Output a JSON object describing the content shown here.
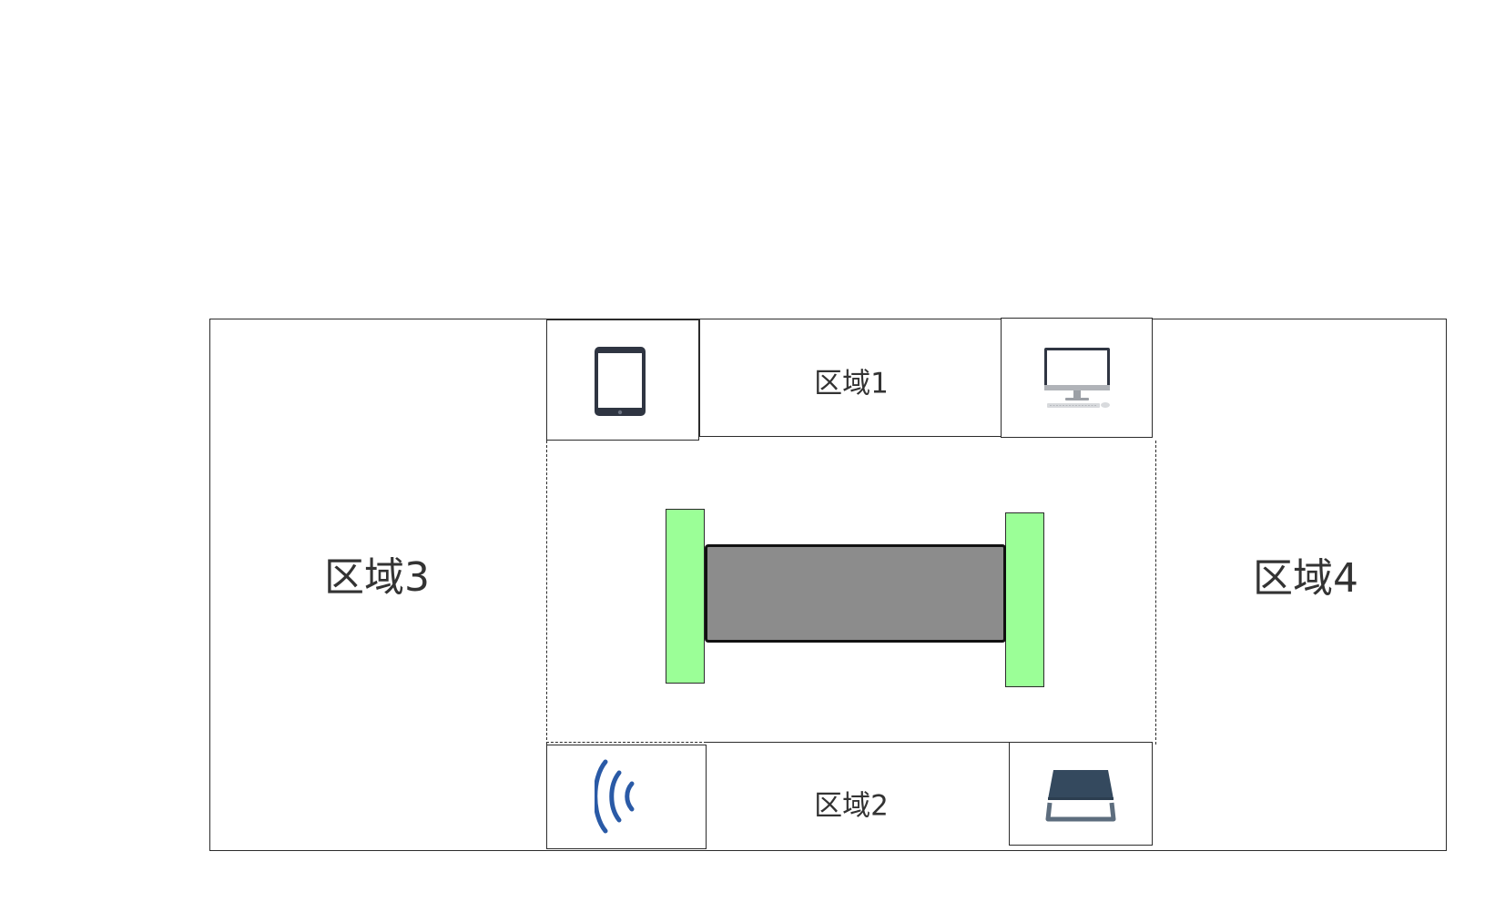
{
  "regions": {
    "region1": "区域1",
    "region2": "区域2",
    "region3": "区域3",
    "region4": "区域4"
  },
  "icons": {
    "top_left": "tablet-icon",
    "top_right": "desktop-computer-icon",
    "bottom_left": "wireless-signal-icon",
    "bottom_right": "scanner-icon"
  },
  "colors": {
    "roller_green": "#9bff97",
    "beam_gray": "#8c8c8c",
    "wireless_blue": "#2a5aa6",
    "scanner_dark": "#34495e",
    "device_dark": "#2f3542"
  }
}
